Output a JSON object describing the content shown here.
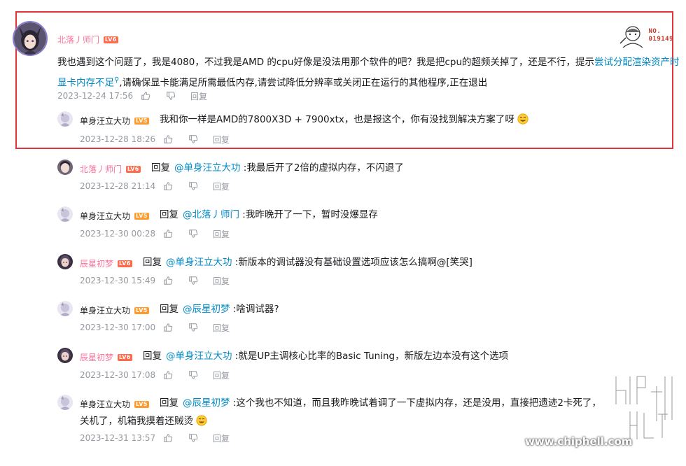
{
  "main_comment": {
    "username": "北落丿师门",
    "level": "LV6",
    "badge_number": "NO.\n019149",
    "text_before_link": "我也遇到这个问题了，我是4080，不过我是AMD 的cpu好像是没法用那个软件的吧？我是把cpu的超频关掉了，还是不行，提示",
    "link_text": "尝试分配渲染资产时显卡内存不足",
    "text_after_link": ",请确保显卡能满足所需最低内存,请尝试降低分辨率或关闭正在运行的其他程序,正在退出",
    "time": "2023-12-24 17:56",
    "reply_label": "回复"
  },
  "replies": [
    {
      "username": "单身汪立大功",
      "level": "LV5",
      "reply_kw": "",
      "at": "",
      "text": "我和你一样是AMD的7800X3D + 7900xtx，也是报这个，你有没找到解决方案了呀",
      "emoji": "face-emoji",
      "time": "2023-12-28 18:26",
      "reply_label": "回复"
    },
    {
      "username": "北落丿师门",
      "level": "LV6",
      "reply_kw": "回复",
      "at": "@单身汪立大功",
      "text": " :我最后开了2倍的虚拟内存，不闪退了",
      "time": "2023-12-28 21:14",
      "reply_label": "回复"
    },
    {
      "username": "单身汪立大功",
      "level": "LV5",
      "reply_kw": "回复",
      "at": "@北落丿师门",
      "text": " :我昨晚开了一下，暂时没爆显存",
      "time": "2023-12-30 00:28",
      "reply_label": "回复"
    },
    {
      "username": "辰星初梦",
      "level": "LV6",
      "reply_kw": "回复",
      "at": "@单身汪立大功",
      "text": " :新版本的调试器没有基础设置选项应该怎么搞啊@[笑哭]",
      "time": "2023-12-30 15:49",
      "reply_label": "回复"
    },
    {
      "username": "单身汪立大功",
      "level": "LV5",
      "reply_kw": "回复",
      "at": "@辰星初梦",
      "text": " :啥调试器?",
      "time": "2023-12-30 17:00",
      "reply_label": "回复"
    },
    {
      "username": "辰星初梦",
      "level": "LV6",
      "reply_kw": "回复",
      "at": "@单身汪立大功",
      "text": " :就是UP主调核心比率的Basic Tuning，新版左边本没有这个选项",
      "time": "2023-12-30 17:08",
      "reply_label": "回复"
    },
    {
      "username": "单身汪立大功",
      "level": "LV5",
      "reply_kw": "回复",
      "at": "@辰星初梦",
      "text": " :这个我也不知道，而且我昨晚试着调了一下虚拟内存，还是没用，直接把遗迹2卡死了，",
      "text_line2": "关机了，机箱我摸着还贼烫",
      "emoji": "face-emoji",
      "time": "2023-12-31 13:57",
      "reply_label": "回复"
    }
  ],
  "watermark": {
    "site": "www.chiphell.com"
  },
  "colors": {
    "highlight_border": "#e0353b",
    "link": "#008ac5",
    "pink_name": "#fb7299",
    "meta_gray": "#9499a0"
  }
}
